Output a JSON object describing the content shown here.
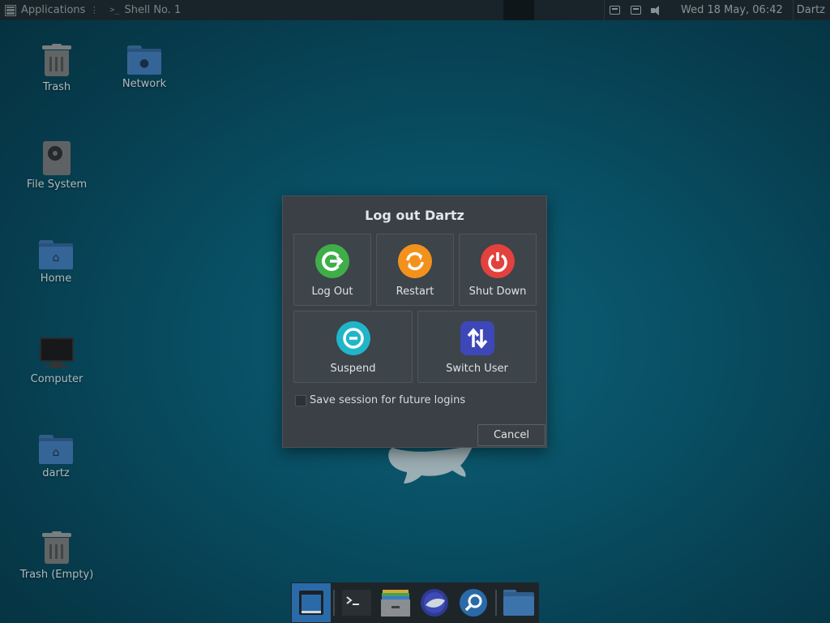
{
  "top_panel": {
    "applications_label": "Applications",
    "task_label": "Shell No. 1",
    "clock": "Wed 18 May, 06:42",
    "user": "Dartz"
  },
  "desktop": {
    "icons": [
      {
        "label": "Trash",
        "icon": "trash-icon"
      },
      {
        "label": "Network",
        "icon": "network-folder-icon"
      },
      {
        "label": "File System",
        "icon": "drive-icon"
      },
      {
        "label": "Home",
        "icon": "home-folder-icon"
      },
      {
        "label": "Computer",
        "icon": "computer-icon"
      },
      {
        "label": "dartz",
        "icon": "home-folder-icon"
      },
      {
        "label": "Trash (Empty)",
        "icon": "trash-icon"
      }
    ]
  },
  "dialog": {
    "title": "Log out Dartz",
    "buttons": {
      "logout": "Log Out",
      "restart": "Restart",
      "shutdown": "Shut Down",
      "suspend": "Suspend",
      "switch_user": "Switch User"
    },
    "save_session_label": "Save session for future logins",
    "save_session_checked": false,
    "cancel_label": "Cancel"
  },
  "colors": {
    "logout": "#3fae49",
    "restart": "#f2921c",
    "shutdown": "#e2413d",
    "suspend": "#21b5c9",
    "switch_user": "#3d47b8"
  },
  "dock": {
    "items": [
      "show-desktop-icon",
      "terminal-icon",
      "file-manager-icon",
      "web-browser-icon",
      "app-finder-icon",
      "folder-icon"
    ]
  }
}
